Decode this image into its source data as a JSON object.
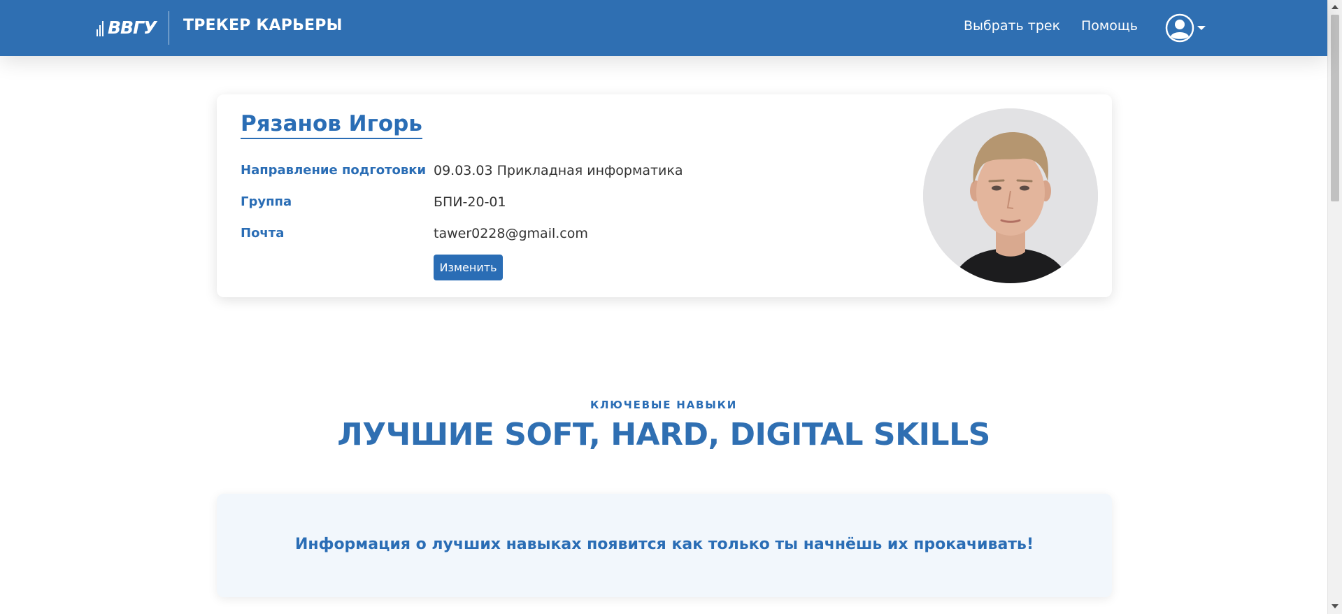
{
  "header": {
    "logo_text": "ВВГУ",
    "app_title": "ТРЕКЕР КАРЬЕРЫ",
    "nav": {
      "choose_track": "Выбрать трек",
      "help": "Помощь"
    },
    "user_icon": "user-circle-icon",
    "brand_color": "#2f6fb2"
  },
  "profile": {
    "name": "Рязанов Игорь",
    "fields": [
      {
        "label": "Направление подготовки",
        "value": "09.03.03 Прикладная информатика"
      },
      {
        "label": "Группа",
        "value": "БПИ-20-01"
      },
      {
        "label": "Почта",
        "value": "tawer0228@gmail.com"
      }
    ],
    "edit_button": "Изменить"
  },
  "skills": {
    "eyebrow": "КЛЮЧЕВЫЕ НАВЫКИ",
    "title": "ЛУЧШИЕ SOFT, HARD, DIGITAL SKILLS",
    "empty_message": "Информация о лучших навыках появится как только ты начнёшь их прокачивать!"
  },
  "colors": {
    "accent": "#2a6db5",
    "panel_bg": "#f2f7fc"
  }
}
